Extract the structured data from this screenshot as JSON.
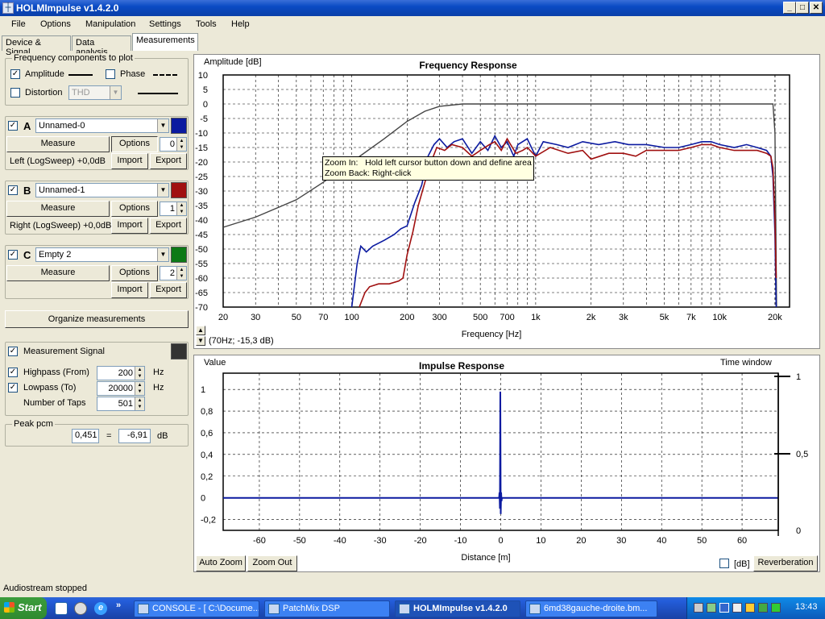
{
  "window": {
    "title": "HOLMImpulse  v1.4.2.0",
    "min": "_",
    "max": "□",
    "close": "✕"
  },
  "menu": [
    "File",
    "Options",
    "Manipulation",
    "Settings",
    "Tools",
    "Help"
  ],
  "tabs": [
    {
      "label": "Device & Signal"
    },
    {
      "label": "Data analysis"
    },
    {
      "label": "Measurements",
      "active": true
    }
  ],
  "freq_components": {
    "title": "Frequency components to plot",
    "amplitude": {
      "label": "Amplitude",
      "checked": true
    },
    "phase": {
      "label": "Phase",
      "checked": false
    },
    "distortion": {
      "label": "Distortion",
      "checked": false,
      "select": "THD"
    }
  },
  "measurements": [
    {
      "letter": "A",
      "checked": true,
      "name": "Unnamed-0",
      "color": "#0b1aa0",
      "measure": "Measure",
      "options": "Options",
      "index": "0",
      "info": "Left (LogSweep) +0,0dB",
      "import": "Import",
      "export": "Export"
    },
    {
      "letter": "B",
      "checked": true,
      "name": "Unnamed-1",
      "color": "#a01010",
      "measure": "Measure",
      "options": "Options",
      "index": "1",
      "info": "Right (LogSweep) +0,0dB",
      "import": "Import",
      "export": "Export"
    },
    {
      "letter": "C",
      "checked": true,
      "name": "Empty 2",
      "color": "#0d7a16",
      "measure": "Measure",
      "options": "Options",
      "index": "2",
      "info": "",
      "import": "Import",
      "export": "Export"
    }
  ],
  "organize": "Organize measurements",
  "signal": {
    "title": "Measurement Signal",
    "checked": true,
    "color": "#333333",
    "highpass": {
      "label": "Highpass (From)",
      "value": "200",
      "unit": "Hz",
      "checked": true
    },
    "lowpass": {
      "label": "Lowpass (To)",
      "value": "20000",
      "unit": "Hz",
      "checked": true
    },
    "taps": {
      "label": "Number of Taps",
      "value": "501"
    }
  },
  "peak": {
    "title": "Peak pcm",
    "value": "0,451",
    "eq": "=",
    "db_value": "-6,91",
    "unit": "dB"
  },
  "freq_plot": {
    "cursor_readout": "(70Hz; -15,3 dB)",
    "up_arrow": "▲",
    "down_arrow": "▼"
  },
  "tooltip": {
    "line1": "Zoom In:   Hold left cursor button down and define area",
    "line2": "Zoom Back: Right-click"
  },
  "impulse_plot": {
    "time_window_label": "Time window",
    "tw_ticks": [
      "1",
      "0,5",
      "0"
    ],
    "auto_zoom": "Auto Zoom",
    "zoom_out": "Zoom Out",
    "db_label": "[dB]",
    "db_checked": false,
    "reverberation": "Reverberation"
  },
  "status": "Audiostream stopped",
  "taskbar": {
    "start": "Start",
    "quick_more": "»",
    "tasks": [
      {
        "label": "CONSOLE - [ C:\\Docume..."
      },
      {
        "label": "PatchMix DSP"
      },
      {
        "label": "HOLMImpulse  v1.4.2.0",
        "active": true
      },
      {
        "label": "6md38gauche-droite.bm..."
      }
    ],
    "clock": "13:43"
  },
  "chart_data": [
    {
      "type": "line",
      "title": "Frequency Response",
      "xlabel": "Frequency [Hz]",
      "ylabel": "Amplitude [dB]",
      "xscale": "log",
      "xlim": [
        20,
        24000
      ],
      "ylim": [
        -70,
        10
      ],
      "x_ticks": [
        20,
        30,
        50,
        70,
        100,
        200,
        300,
        500,
        700,
        1000,
        2000,
        3000,
        5000,
        7000,
        10000,
        20000
      ],
      "x_tick_labels": [
        "20",
        "30",
        "50",
        "70",
        "100",
        "200",
        "300",
        "500",
        "700",
        "1k",
        "2k",
        "3k",
        "5k",
        "7k",
        "10k",
        "20k"
      ],
      "y_ticks": [
        10,
        5,
        0,
        -5,
        -10,
        -15,
        -20,
        -25,
        -30,
        -35,
        -40,
        -45,
        -50,
        -55,
        -60,
        -65,
        -70
      ],
      "grid": true,
      "series": [
        {
          "color": "#444444",
          "points": [
            [
              20,
              -42.5
            ],
            [
              30,
              -39
            ],
            [
              50,
              -33
            ],
            [
              70,
              -27
            ],
            [
              100,
              -20
            ],
            [
              150,
              -12
            ],
            [
              200,
              -6
            ],
            [
              250,
              -2.5
            ],
            [
              300,
              -0.8
            ],
            [
              400,
              0
            ],
            [
              1000,
              0
            ],
            [
              10000,
              0
            ],
            [
              19500,
              0
            ],
            [
              20000,
              -10
            ],
            [
              20200,
              -40
            ],
            [
              20400,
              -70
            ]
          ]
        },
        {
          "color": "#0b1aa0",
          "points": [
            [
              100,
              -70
            ],
            [
              107,
              -55
            ],
            [
              112,
              -49
            ],
            [
              120,
              -51
            ],
            [
              130,
              -49
            ],
            [
              150,
              -47
            ],
            [
              170,
              -45
            ],
            [
              185,
              -43
            ],
            [
              200,
              -42
            ],
            [
              220,
              -34
            ],
            [
              240,
              -28
            ],
            [
              260,
              -18
            ],
            [
              280,
              -14
            ],
            [
              300,
              -12
            ],
            [
              330,
              -15
            ],
            [
              360,
              -13
            ],
            [
              400,
              -12
            ],
            [
              450,
              -17
            ],
            [
              500,
              -13
            ],
            [
              550,
              -16
            ],
            [
              600,
              -11
            ],
            [
              650,
              -15
            ],
            [
              700,
              -13
            ],
            [
              760,
              -18
            ],
            [
              800,
              -14
            ],
            [
              900,
              -12
            ],
            [
              1000,
              -18
            ],
            [
              1100,
              -13
            ],
            [
              1300,
              -14
            ],
            [
              1500,
              -15
            ],
            [
              1800,
              -13
            ],
            [
              2200,
              -14
            ],
            [
              2700,
              -13
            ],
            [
              3200,
              -14
            ],
            [
              4000,
              -14
            ],
            [
              5000,
              -15
            ],
            [
              6000,
              -15
            ],
            [
              7000,
              -14
            ],
            [
              8000,
              -13
            ],
            [
              9000,
              -13
            ],
            [
              10000,
              -14
            ],
            [
              12000,
              -15
            ],
            [
              14000,
              -14
            ],
            [
              16000,
              -15
            ],
            [
              18000,
              -16
            ],
            [
              19000,
              -18
            ],
            [
              19500,
              -25
            ],
            [
              20000,
              -45
            ],
            [
              20300,
              -70
            ]
          ]
        },
        {
          "color": "#a01010",
          "points": [
            [
              110,
              -70
            ],
            [
              118,
              -65
            ],
            [
              125,
              -63
            ],
            [
              140,
              -62
            ],
            [
              160,
              -62
            ],
            [
              180,
              -61
            ],
            [
              190,
              -60
            ],
            [
              200,
              -52
            ],
            [
              215,
              -44
            ],
            [
              230,
              -35
            ],
            [
              250,
              -27
            ],
            [
              270,
              -20
            ],
            [
              290,
              -15
            ],
            [
              320,
              -16
            ],
            [
              350,
              -14
            ],
            [
              400,
              -15
            ],
            [
              450,
              -18
            ],
            [
              500,
              -16
            ],
            [
              560,
              -14
            ],
            [
              600,
              -13
            ],
            [
              650,
              -16
            ],
            [
              700,
              -12
            ],
            [
              780,
              -17
            ],
            [
              850,
              -16
            ],
            [
              900,
              -15
            ],
            [
              1000,
              -18
            ],
            [
              1200,
              -15
            ],
            [
              1500,
              -17
            ],
            [
              1800,
              -16
            ],
            [
              2000,
              -19
            ],
            [
              2500,
              -17
            ],
            [
              3000,
              -17
            ],
            [
              3500,
              -18
            ],
            [
              4000,
              -16
            ],
            [
              5000,
              -16
            ],
            [
              6000,
              -16
            ],
            [
              7000,
              -15
            ],
            [
              8000,
              -14
            ],
            [
              9000,
              -14
            ],
            [
              10000,
              -15
            ],
            [
              12000,
              -16
            ],
            [
              14000,
              -16
            ],
            [
              16000,
              -16
            ],
            [
              18000,
              -17
            ],
            [
              19000,
              -18
            ],
            [
              19500,
              -22
            ],
            [
              20000,
              -40
            ],
            [
              20300,
              -60
            ]
          ]
        }
      ]
    },
    {
      "type": "line",
      "title": "Impulse Response",
      "xlabel": "Distance [m]",
      "ylabel": "Value",
      "xlim": [
        -69,
        69
      ],
      "ylim": [
        -0.3,
        1.15
      ],
      "x_ticks": [
        -60,
        -50,
        -40,
        -30,
        -20,
        -10,
        0,
        10,
        20,
        30,
        40,
        50,
        60
      ],
      "y_ticks": [
        1,
        0.8,
        0.6,
        0.4,
        0.2,
        0,
        -0.2
      ],
      "y_tick_labels": [
        "1",
        "0,8",
        "0,6",
        "0,4",
        "0,2",
        "0",
        "-0,2"
      ],
      "grid": true,
      "series": [
        {
          "color": "#0b1aa0",
          "points": [
            [
              -69,
              0
            ],
            [
              -0.4,
              0
            ],
            [
              -0.3,
              0.05
            ],
            [
              -0.2,
              -0.1
            ],
            [
              -0.1,
              0.98
            ],
            [
              0,
              -0.15
            ],
            [
              0.1,
              0.05
            ],
            [
              0.2,
              -0.03
            ],
            [
              0.3,
              0
            ],
            [
              69,
              0
            ]
          ]
        }
      ]
    }
  ]
}
